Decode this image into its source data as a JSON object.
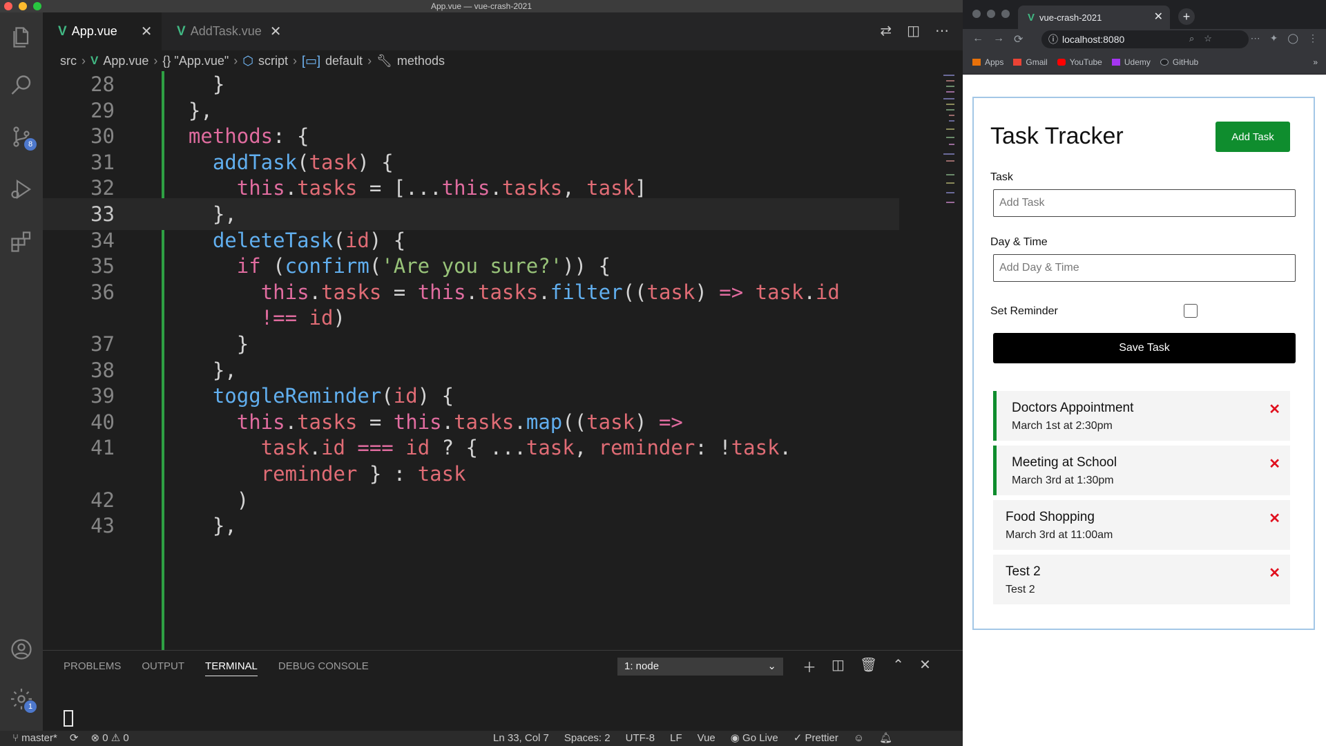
{
  "window_title": "App.vue — vue-crash-2021",
  "editor_tabs": [
    {
      "label": "App.vue",
      "close": "✕"
    },
    {
      "label": "AddTask.vue",
      "close": "✕"
    }
  ],
  "breadcrumb": [
    "src",
    "App.vue",
    "{} \"App.vue\"",
    "script",
    "default",
    "methods"
  ],
  "activity_badges": {
    "source_control": "8",
    "settings": "1"
  },
  "code_lines": [
    {
      "n": "28",
      "text": "    }"
    },
    {
      "n": "29",
      "text": "  },"
    },
    {
      "n": "30",
      "text": "  methods: {"
    },
    {
      "n": "31",
      "text": "    addTask(task) {"
    },
    {
      "n": "32",
      "text": "      this.tasks = [...this.tasks, task]"
    },
    {
      "n": "33",
      "text": "    },"
    },
    {
      "n": "34",
      "text": "    deleteTask(id) {"
    },
    {
      "n": "35",
      "text": "      if (confirm('Are you sure?')) {"
    },
    {
      "n": "36",
      "text": "        this.tasks = this.tasks.filter((task) => task.id"
    },
    {
      "n": "",
      "text": "        !== id)"
    },
    {
      "n": "37",
      "text": "      }"
    },
    {
      "n": "38",
      "text": "    },"
    },
    {
      "n": "39",
      "text": "    toggleReminder(id) {"
    },
    {
      "n": "40",
      "text": "      this.tasks = this.tasks.map((task) =>"
    },
    {
      "n": "41",
      "text": "        task.id === id ? { ...task, reminder: !task."
    },
    {
      "n": "",
      "text": "        reminder } : task"
    },
    {
      "n": "42",
      "text": "      )"
    },
    {
      "n": "43",
      "text": "    },"
    }
  ],
  "panel": {
    "tabs": [
      "PROBLEMS",
      "OUTPUT",
      "TERMINAL",
      "DEBUG CONSOLE"
    ],
    "active_tab": "TERMINAL",
    "terminal_select": "1: node"
  },
  "statusbar": {
    "branch": "master*",
    "errors": "0",
    "warnings": "0",
    "position": "Ln 33, Col 7",
    "spaces": "Spaces: 2",
    "encoding": "UTF-8",
    "eol": "LF",
    "language": "Vue",
    "go_live": "Go Live",
    "prettier": "Prettier"
  },
  "browser": {
    "tab_title": "vue-crash-2021",
    "url": "localhost:8080",
    "bookmarks": [
      "Apps",
      "Gmail",
      "YouTube",
      "Udemy",
      "GitHub"
    ]
  },
  "app": {
    "title": "Task Tracker",
    "add_button": "Add Task",
    "task_label": "Task",
    "task_placeholder": "Add Task",
    "day_label": "Day & Time",
    "day_placeholder": "Add Day & Time",
    "reminder_label": "Set Reminder",
    "save_button": "Save Task",
    "tasks": [
      {
        "text": "Doctors Appointment",
        "day": "March 1st at 2:30pm",
        "reminder": true
      },
      {
        "text": "Meeting at School",
        "day": "March 3rd at 1:30pm",
        "reminder": true
      },
      {
        "text": "Food Shopping",
        "day": "March 3rd at 11:00am",
        "reminder": false
      },
      {
        "text": "Test 2",
        "day": "Test 2",
        "reminder": false
      }
    ]
  },
  "colors": {
    "vue_green": "#41b883",
    "editor_bg": "#1e1e1e",
    "add_button": "#0f8d2e",
    "delete_x": "#e0101e"
  }
}
